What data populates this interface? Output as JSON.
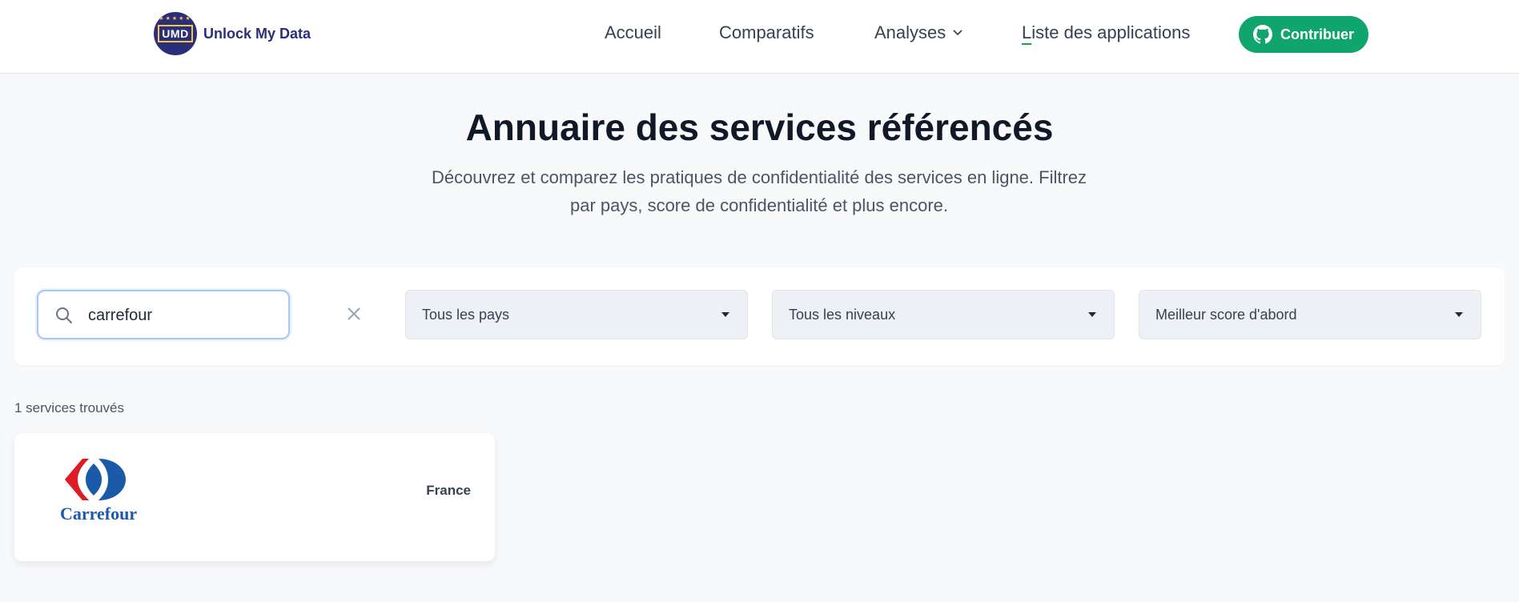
{
  "header": {
    "logo_text": "Unlock My Data",
    "logo_badge": "UMD",
    "nav": {
      "accueil": "Accueil",
      "comparatifs": "Comparatifs",
      "analyses": "Analyses",
      "liste_first": "L",
      "liste_rest": "iste des applications"
    },
    "contribute_label": "Contribuer"
  },
  "hero": {
    "title": "Annuaire des services référencés",
    "subtitle": "Découvrez et comparez les pratiques de confidentialité des services en ligne. Filtrez par pays, score de confidentialité et plus encore."
  },
  "filters": {
    "search_value": "carrefour",
    "country_select": "Tous les pays",
    "level_select": "Tous les niveaux",
    "sort_select": "Meilleur score d'abord"
  },
  "results": {
    "count_text": "1 services trouvés",
    "items": [
      {
        "name": "Carrefour",
        "country": "France"
      }
    ]
  },
  "colors": {
    "accent_green": "#10a56d",
    "brand_navy": "#2b2f7a",
    "carrefour_blue": "#1b5aa8",
    "carrefour_red": "#e01b24"
  }
}
